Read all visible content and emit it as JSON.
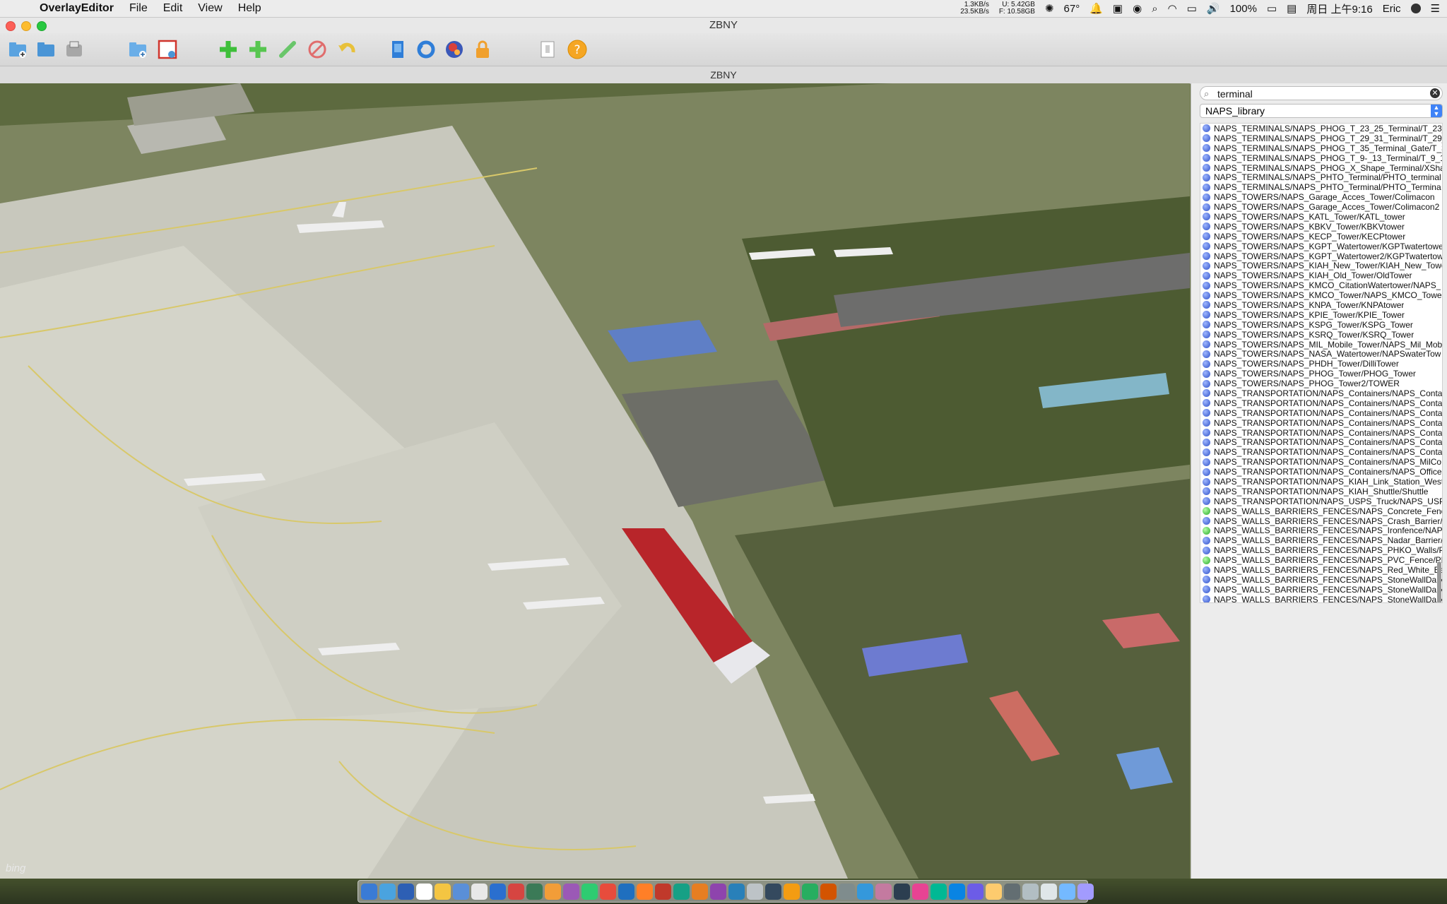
{
  "menubar": {
    "app": "OverlayEditor",
    "menus": [
      "File",
      "Edit",
      "View",
      "Help"
    ],
    "net_up": "1.3KB/s",
    "net_down": "23.5KB/s",
    "disk_u": "U: 5.42GB",
    "disk_f": "F: 10.58GB",
    "temp": "67°",
    "battery": "100%",
    "clock": "周日 上午9:16",
    "user": "Eric"
  },
  "window": {
    "title": "ZBNY",
    "subtitle": "ZBNY"
  },
  "toolbar": {
    "icons": [
      "new-file-icon",
      "open-folder-icon",
      "save-icon",
      "new-package-icon",
      "import-icon",
      "add-object-icon",
      "add-facade-icon",
      "edit-path-icon",
      "delete-icon",
      "undo-icon",
      "building-icon",
      "refresh-icon",
      "globe-icon",
      "lock-icon",
      "import-image-icon",
      "help-icon"
    ]
  },
  "panel": {
    "search_value": "terminal",
    "library": "NAPS_library",
    "items": [
      {
        "t": "NAPS_TERMINALS/NAPS_PHOG_T_23_25_Terminal/T_23_",
        "c": "blue"
      },
      {
        "t": "NAPS_TERMINALS/NAPS_PHOG_T_29_31_Terminal/T_29_",
        "c": "blue"
      },
      {
        "t": "NAPS_TERMINALS/NAPS_PHOG_T_35_Terminal_Gate/T_3",
        "c": "blue"
      },
      {
        "t": "NAPS_TERMINALS/NAPS_PHOG_T_9-_13_Terminal/T_9_13",
        "c": "blue"
      },
      {
        "t": "NAPS_TERMINALS/NAPS_PHOG_X_Shape_Terminal/XSha",
        "c": "blue"
      },
      {
        "t": "NAPS_TERMINALS/NAPS_PHTO_Terminal/PHTO_terminal",
        "c": "blue"
      },
      {
        "t": "NAPS_TERMINALS/NAPS_PHTO_Terminal/PHTO_Termina",
        "c": "blue"
      },
      {
        "t": "NAPS_TOWERS/NAPS_Garage_Acces_Tower/Colimacon",
        "c": "blue"
      },
      {
        "t": "NAPS_TOWERS/NAPS_Garage_Acces_Tower/Colimacon2",
        "c": "blue"
      },
      {
        "t": "NAPS_TOWERS/NAPS_KATL_Tower/KATL_tower",
        "c": "blue"
      },
      {
        "t": "NAPS_TOWERS/NAPS_KBKV_Tower/KBKVtower",
        "c": "blue"
      },
      {
        "t": "NAPS_TOWERS/NAPS_KECP_Tower/KECPtower",
        "c": "blue"
      },
      {
        "t": "NAPS_TOWERS/NAPS_KGPT_Watertower/KGPTwatertowe",
        "c": "blue"
      },
      {
        "t": "NAPS_TOWERS/NAPS_KGPT_Watertower2/KGPTwatertow",
        "c": "blue"
      },
      {
        "t": "NAPS_TOWERS/NAPS_KIAH_New_Tower/KIAH_New_Towe",
        "c": "blue"
      },
      {
        "t": "NAPS_TOWERS/NAPS_KIAH_Old_Tower/OldTower",
        "c": "blue"
      },
      {
        "t": "NAPS_TOWERS/NAPS_KMCO_CitationWatertower/NAPS_",
        "c": "blue"
      },
      {
        "t": "NAPS_TOWERS/NAPS_KMCO_Tower/NAPS_KMCO_Tower",
        "c": "blue"
      },
      {
        "t": "NAPS_TOWERS/NAPS_KNPA_Tower/KNPAtower",
        "c": "blue"
      },
      {
        "t": "NAPS_TOWERS/NAPS_KPIE_Tower/KPIE_Tower",
        "c": "blue"
      },
      {
        "t": "NAPS_TOWERS/NAPS_KSPG_Tower/KSPG_Tower",
        "c": "blue"
      },
      {
        "t": "NAPS_TOWERS/NAPS_KSRQ_Tower/KSRQ_Tower",
        "c": "blue"
      },
      {
        "t": "NAPS_TOWERS/NAPS_MIL_Mobile_Tower/NAPS_Mil_Mob",
        "c": "blue"
      },
      {
        "t": "NAPS_TOWERS/NAPS_NASA_Watertower/NAPSwaterTow",
        "c": "blue"
      },
      {
        "t": "NAPS_TOWERS/NAPS_PHDH_Tower/DilliTower",
        "c": "blue"
      },
      {
        "t": "NAPS_TOWERS/NAPS_PHOG_Tower/PHOG_Tower",
        "c": "blue"
      },
      {
        "t": "NAPS_TOWERS/NAPS_PHOG_Tower2/TOWER",
        "c": "blue"
      },
      {
        "t": "NAPS_TRANSPORTATION/NAPS_Containers/NAPS_Conta",
        "c": "blue"
      },
      {
        "t": "NAPS_TRANSPORTATION/NAPS_Containers/NAPS_Conta",
        "c": "blue"
      },
      {
        "t": "NAPS_TRANSPORTATION/NAPS_Containers/NAPS_Conta",
        "c": "blue"
      },
      {
        "t": "NAPS_TRANSPORTATION/NAPS_Containers/NAPS_Conta",
        "c": "blue"
      },
      {
        "t": "NAPS_TRANSPORTATION/NAPS_Containers/NAPS_Conta",
        "c": "blue"
      },
      {
        "t": "NAPS_TRANSPORTATION/NAPS_Containers/NAPS_Conta",
        "c": "blue"
      },
      {
        "t": "NAPS_TRANSPORTATION/NAPS_Containers/NAPS_Conta",
        "c": "blue"
      },
      {
        "t": "NAPS_TRANSPORTATION/NAPS_Containers/NAPS_MilCo",
        "c": "blue"
      },
      {
        "t": "NAPS_TRANSPORTATION/NAPS_Containers/NAPS_Office",
        "c": "blue"
      },
      {
        "t": "NAPS_TRANSPORTATION/NAPS_KIAH_Link_Station_West",
        "c": "blue"
      },
      {
        "t": "NAPS_TRANSPORTATION/NAPS_KIAH_Shuttle/Shuttle",
        "c": "blue"
      },
      {
        "t": "NAPS_TRANSPORTATION/NAPS_USPS_Truck/NAPS_USP",
        "c": "blue"
      },
      {
        "t": "NAPS_WALLS_BARRIERS_FENCES/NAPS_Concrete_Fenc",
        "c": "green"
      },
      {
        "t": "NAPS_WALLS_BARRIERS_FENCES/NAPS_Crash_Barrier/N",
        "c": "blue"
      },
      {
        "t": "NAPS_WALLS_BARRIERS_FENCES/NAPS_Ironfence/NAPS",
        "c": "green"
      },
      {
        "t": "NAPS_WALLS_BARRIERS_FENCES/NAPS_Nadar_Barrier/N",
        "c": "blue"
      },
      {
        "t": "NAPS_WALLS_BARRIERS_FENCES/NAPS_PHKO_Walls/Ph",
        "c": "blue"
      },
      {
        "t": "NAPS_WALLS_BARRIERS_FENCES/NAPS_PVC_Fence/PH",
        "c": "green"
      },
      {
        "t": "NAPS_WALLS_BARRIERS_FENCES/NAPS_Red_White_Barri",
        "c": "blue"
      },
      {
        "t": "NAPS_WALLS_BARRIERS_FENCES/NAPS_StoneWallDark/",
        "c": "blue"
      },
      {
        "t": "NAPS_WALLS_BARRIERS_FENCES/NAPS_StoneWallDark/",
        "c": "blue"
      },
      {
        "t": "NAPS_WALLS_BARRIERS_FENCES/NAPS_StoneWallDark/",
        "c": "blue"
      }
    ]
  },
  "map": {
    "attribution": "bing"
  },
  "colors": {
    "accent": "#3e82f7",
    "building_roof": "#b8252a"
  }
}
